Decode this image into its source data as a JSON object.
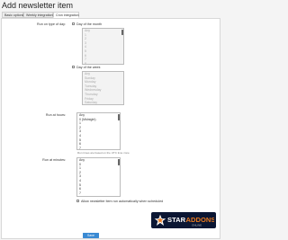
{
  "page": {
    "title": "Add newsletter item"
  },
  "tabs": [
    "Basic options",
    "Weekly integrations",
    "Cron integration"
  ],
  "active_tab": 2,
  "form": {
    "run_on_type_of_day_label": "Run on type of day:",
    "day_of_month_label": "Day of the month",
    "day_of_month_options": [
      "Any",
      "1",
      "2",
      "3",
      "4",
      "5",
      "6",
      "7",
      "8"
    ],
    "day_of_week_label": "Day of the week",
    "day_of_week_options": [
      "Any",
      "Sunday",
      "Monday",
      "Tuesday",
      "Wednesday",
      "Thursday",
      "Friday",
      "Saturday"
    ],
    "run_at_hours_label": "Run at hours:",
    "hours_options": [
      "Any",
      "0 (Midnight)",
      "1",
      "2",
      "3",
      "4",
      "5",
      "6",
      "7"
    ],
    "hours_note": "Run times are based on the UTC time zone",
    "run_at_minutes_label": "Run at minutes:",
    "minutes_options": [
      "Any",
      "0",
      "1",
      "2",
      "3",
      "4",
      "5",
      "6",
      "7"
    ],
    "allow_label": "Allow newsletter item run automatically when scheduled",
    "save_label": "Save"
  },
  "watermark": {
    "text": "STARADDONS",
    "subtext": "ONLINE"
  },
  "colors": {
    "accent": "#3a8ad3",
    "watermark_bg": "#0b1633",
    "watermark_orange": "#e8791e"
  }
}
